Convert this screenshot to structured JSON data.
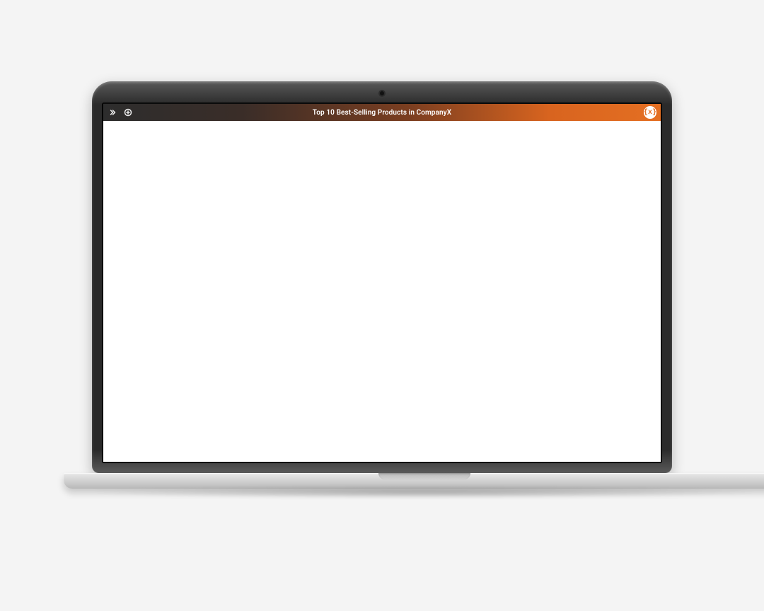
{
  "topbar": {
    "title": "Top 10 Best-Selling Products in CompanyX",
    "expand_icon": "chevrons-right-icon",
    "add_icon": "plus-circle-icon",
    "logo_text": "{x}"
  }
}
